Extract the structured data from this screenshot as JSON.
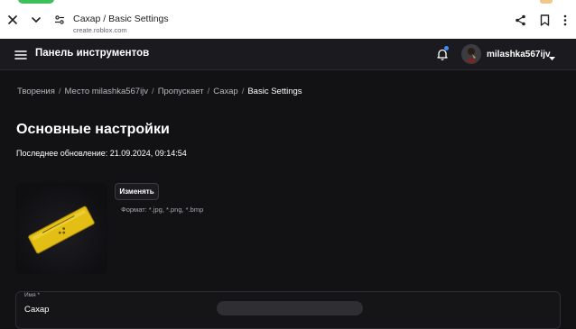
{
  "browser": {
    "tab_title": "Сахар / Basic Settings",
    "url": "create.roblox.com"
  },
  "header": {
    "title": "Панель инструментов",
    "username": "milashka567ijv"
  },
  "breadcrumb": {
    "items": [
      "Творения",
      "Место milashka567ijv",
      "Пропускает",
      "Сахар"
    ],
    "current": "Basic Settings",
    "separator": "/"
  },
  "page": {
    "title": "Основные настройки",
    "last_updated": "Последнее обновление: 21.09.2024, 09:14:54"
  },
  "thumbnail": {
    "change_label": "Изменять",
    "format_hint": "Формат: *.jpg, *.png, *.bmp"
  },
  "name_field": {
    "label": "Имя *",
    "value": "Сахар"
  },
  "colors": {
    "accent": "#3d8bff",
    "background": "#121215",
    "item": "#e8c21a"
  }
}
